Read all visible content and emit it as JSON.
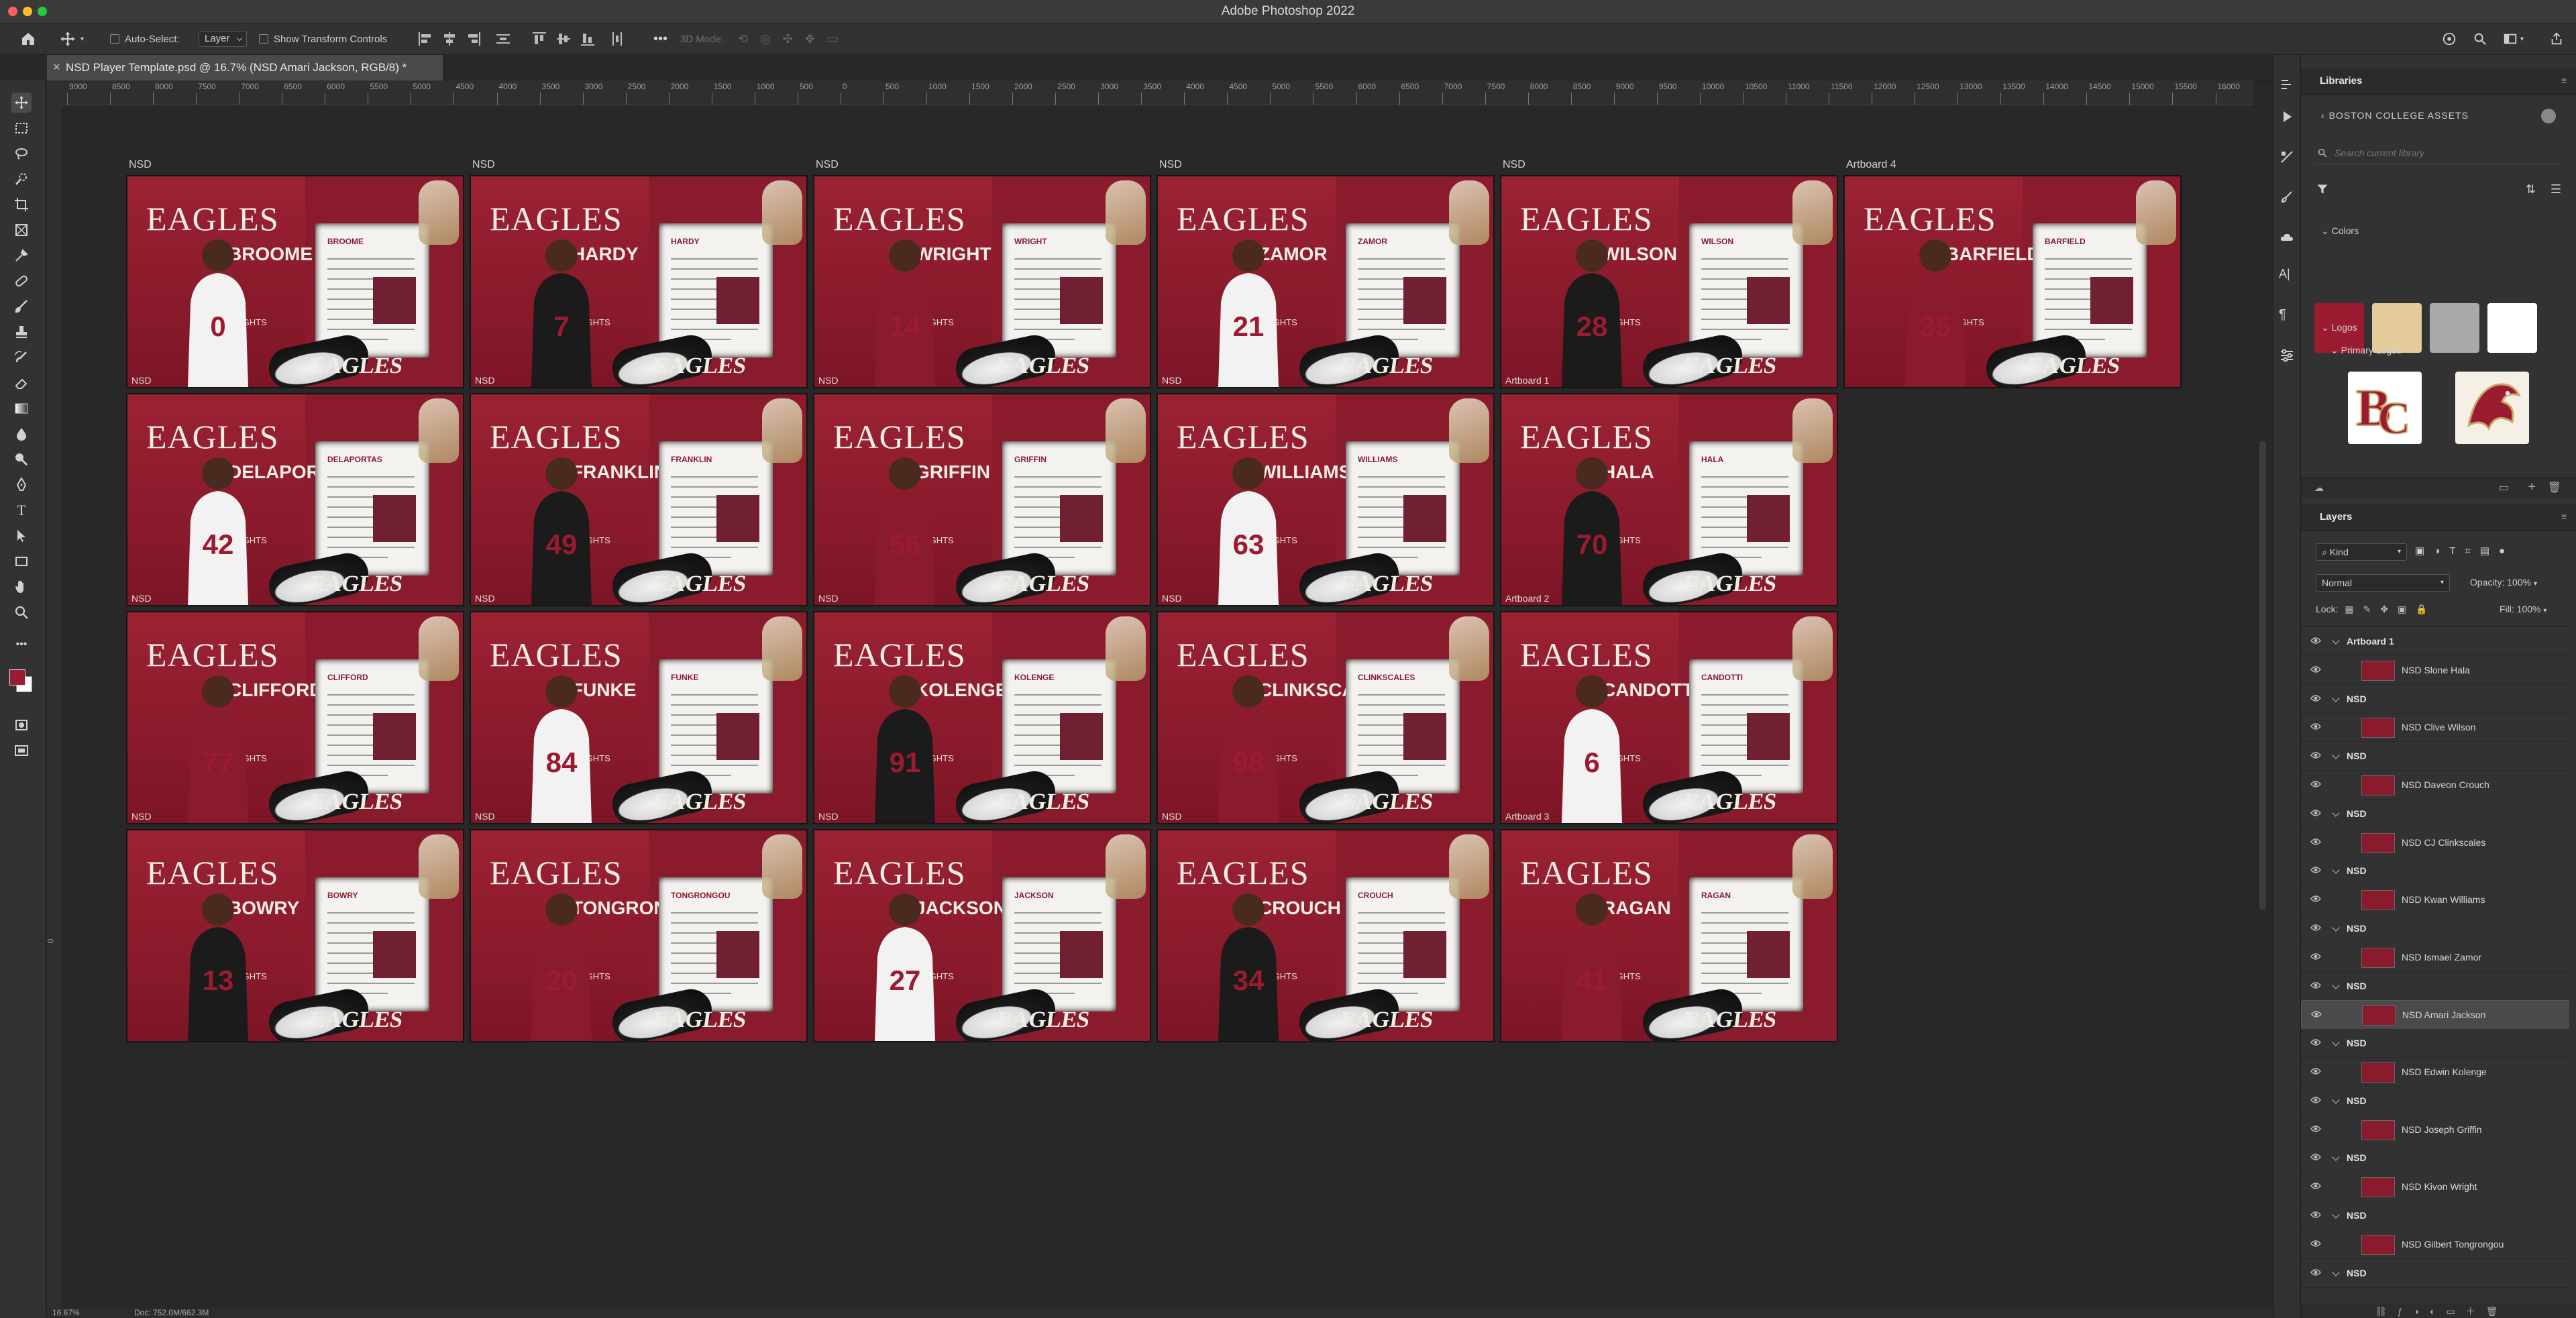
{
  "window": {
    "title": "Adobe Photoshop 2022"
  },
  "options_bar": {
    "auto_select_label": "Auto-Select:",
    "auto_select_value": "Layer",
    "transform_controls_label": "Show Transform Controls",
    "mode_3d_label": "3D Mode:"
  },
  "document_tab": {
    "title": "NSD  Player Template.psd @ 16.7% (NSD Amari Jackson, RGB/8) *"
  },
  "ruler": {
    "labels": [
      "9000",
      "8500",
      "8000",
      "7500",
      "7000",
      "6500",
      "6000",
      "5500",
      "5000",
      "4500",
      "4000",
      "3500",
      "3000",
      "2500",
      "2000",
      "1500",
      "1000",
      "500",
      "0",
      "500",
      "1000",
      "1500",
      "2000",
      "2500",
      "3000",
      "3500",
      "4000",
      "4500",
      "5000",
      "5500",
      "6000",
      "6500",
      "7000",
      "7500",
      "8000",
      "8500",
      "9000",
      "9500",
      "10000",
      "10500",
      "11000",
      "11500",
      "12000",
      "12500",
      "13000",
      "13500",
      "14000",
      "14500",
      "15000",
      "15500",
      "16000",
      "16500",
      "17"
    ]
  },
  "vertical_ruler": {
    "labels": [
      "0"
    ]
  },
  "artboards": [
    {
      "label": "NSD",
      "bottom_label": "NSD",
      "name": "BROOME",
      "page_name": "BROOME"
    },
    {
      "label": "NSD",
      "bottom_label": "NSD",
      "name": "HARDY",
      "page_name": "HARDY"
    },
    {
      "label": "NSD",
      "bottom_label": "NSD",
      "name": "WRIGHT",
      "page_name": "WRIGHT"
    },
    {
      "label": "NSD",
      "bottom_label": "NSD",
      "name": "ZAMOR",
      "page_name": "ZAMOR"
    },
    {
      "label": "NSD",
      "bottom_label": "Artboard 1",
      "name": "WILSON",
      "page_name": "WILSON"
    },
    {
      "label": "Artboard 4",
      "bottom_label": "",
      "name": "BARFIELD",
      "page_name": "BARFIELD"
    },
    {
      "label": "",
      "bottom_label": "NSD",
      "name": "DELAPORTAS",
      "page_name": "DELAPORTAS"
    },
    {
      "label": "",
      "bottom_label": "NSD",
      "name": "FRANKLIN",
      "page_name": "FRANKLIN"
    },
    {
      "label": "",
      "bottom_label": "NSD",
      "name": "GRIFFIN",
      "page_name": "GRIFFIN"
    },
    {
      "label": "",
      "bottom_label": "NSD",
      "name": "WILLIAMS",
      "page_name": "WILLIAMS"
    },
    {
      "label": "",
      "bottom_label": "Artboard 2",
      "name": "HALA",
      "page_name": "HALA"
    },
    {
      "label": "",
      "bottom_label": "NSD",
      "name": "CLIFFORD",
      "page_name": "CLIFFORD"
    },
    {
      "label": "",
      "bottom_label": "NSD",
      "name": "FUNKE",
      "page_name": "FUNKE"
    },
    {
      "label": "",
      "bottom_label": "NSD",
      "name": "KOLENGE",
      "page_name": "KOLENGE"
    },
    {
      "label": "",
      "bottom_label": "NSD",
      "name": "CLINKSCALES",
      "page_name": "CLINKSCALES"
    },
    {
      "label": "",
      "bottom_label": "Artboard 3",
      "name": "CANDOTTI",
      "page_name": "CANDOTTI"
    },
    {
      "label": "",
      "bottom_label": "",
      "name": "BOWRY",
      "page_name": "BOWRY"
    },
    {
      "label": "",
      "bottom_label": "",
      "name": "TONGRONGOU",
      "page_name": "TONGRONGOU"
    },
    {
      "label": "",
      "bottom_label": "",
      "name": "JACKSON",
      "page_name": "JACKSON"
    },
    {
      "label": "",
      "bottom_label": "",
      "name": "CROUCH",
      "page_name": "CROUCH"
    },
    {
      "label": "",
      "bottom_label": "",
      "name": "RAGAN",
      "page_name": "RAGAN"
    }
  ],
  "artboard_brand": "EAGLES",
  "artboard_heights_label": "HEIGHTS",
  "libraries": {
    "panel_title": "Libraries",
    "library_name": "BOSTON COLLEGE ASSETS",
    "search_placeholder": "Search current library",
    "colors_label": "Colors",
    "colors": [
      "#9b1b30",
      "#e3cc9a",
      "#a9a9a9",
      "#ffffff"
    ],
    "logos_label": "Logos",
    "primary_logos_label": "Primary Logos"
  },
  "layers": {
    "panel_title": "Layers",
    "filter_kind": "Kind",
    "blend_mode": "Normal",
    "opacity_label": "Opacity:",
    "opacity_value": "100%",
    "lock_label": "Lock:",
    "fill_label": "Fill:",
    "fill_value": "100%",
    "rows": [
      {
        "type": "group",
        "name": "Artboard 1",
        "selected": false
      },
      {
        "type": "layer",
        "name": "NSD Slone Hala",
        "selected": false
      },
      {
        "type": "group",
        "name": "NSD",
        "selected": false
      },
      {
        "type": "layer",
        "name": "NSD Clive Wilson",
        "selected": false
      },
      {
        "type": "group",
        "name": "NSD",
        "selected": false
      },
      {
        "type": "layer",
        "name": "NSD Daveon Crouch",
        "selected": false
      },
      {
        "type": "group",
        "name": "NSD",
        "selected": false
      },
      {
        "type": "layer",
        "name": "NSD CJ Clinkscales",
        "selected": false
      },
      {
        "type": "group",
        "name": "NSD",
        "selected": false
      },
      {
        "type": "layer",
        "name": "NSD Kwan Williams",
        "selected": false
      },
      {
        "type": "group",
        "name": "NSD",
        "selected": false
      },
      {
        "type": "layer",
        "name": "NSD Ismael Zamor",
        "selected": false
      },
      {
        "type": "group",
        "name": "NSD",
        "selected": false
      },
      {
        "type": "layer",
        "name": "NSD Amari Jackson",
        "selected": true
      },
      {
        "type": "group",
        "name": "NSD",
        "selected": false
      },
      {
        "type": "layer",
        "name": "NSD Edwin Kolenge",
        "selected": false
      },
      {
        "type": "group",
        "name": "NSD",
        "selected": false
      },
      {
        "type": "layer",
        "name": "NSD Joseph Griffin",
        "selected": false
      },
      {
        "type": "group",
        "name": "NSD",
        "selected": false
      },
      {
        "type": "layer",
        "name": "NSD Kivon Wright",
        "selected": false
      },
      {
        "type": "group",
        "name": "NSD",
        "selected": false
      },
      {
        "type": "layer",
        "name": "NSD Gilbert Tongrongou",
        "selected": false
      },
      {
        "type": "group",
        "name": "NSD",
        "selected": false
      }
    ]
  },
  "status_bar": {
    "zoom": "16.67%",
    "doc": "Doc: 752.0M/662.3M"
  },
  "colors": {
    "foreground": "#9b1b30",
    "background": "#ffffff",
    "accent_red": "#8a1b2c"
  }
}
